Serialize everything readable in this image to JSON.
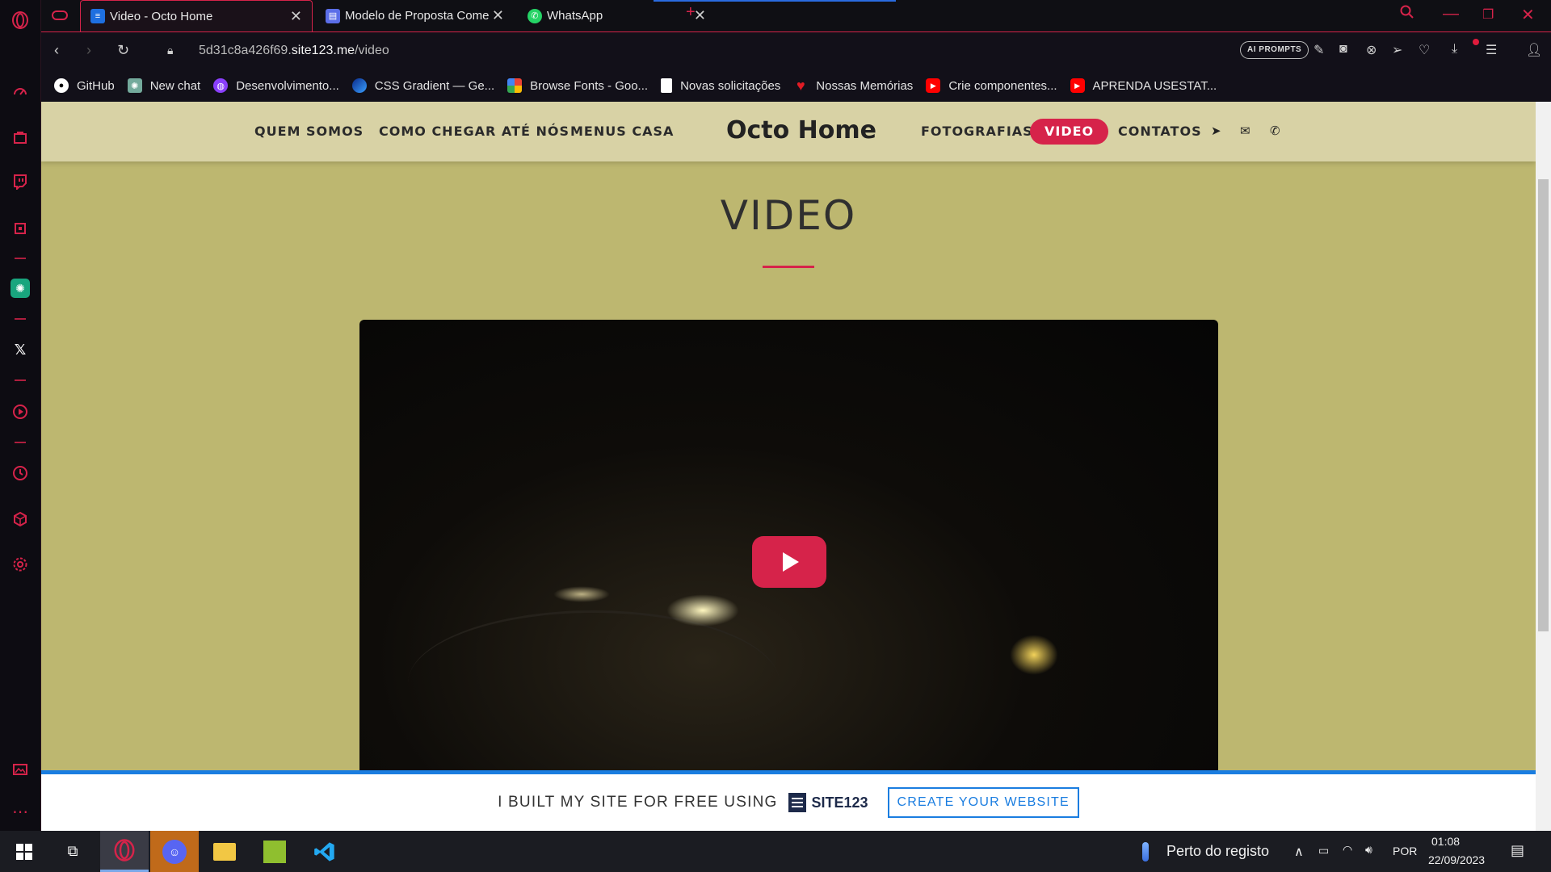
{
  "browser": {
    "tabs": [
      {
        "title": "Video - Octo Home",
        "active": true,
        "favicon": "site123-icon"
      },
      {
        "title": "Modelo de Proposta Come",
        "active": false,
        "favicon": "docs-icon"
      },
      {
        "title": "WhatsApp",
        "active": false,
        "favicon": "whatsapp-icon"
      }
    ],
    "new_tab_symbol": "+",
    "url_prefix": "5d31c8a426f69.",
    "url_host": "site123.me",
    "url_path": "/video",
    "ai_prompts_label": "AI PROMPTS",
    "bookmarks": [
      {
        "label": "GitHub",
        "icon": "github-icon",
        "color": "#ffffff"
      },
      {
        "label": "New chat",
        "icon": "chatgpt-icon",
        "color": "#74aa9c"
      },
      {
        "label": "Desenvolvimento...",
        "icon": "purple-circle-icon",
        "color": "#8a3ffc"
      },
      {
        "label": "CSS Gradient — Ge...",
        "icon": "gradient-icon",
        "color": "#1e63d6"
      },
      {
        "label": "Browse Fonts - Goo...",
        "icon": "google-fonts-icon",
        "color": "#f4b400"
      },
      {
        "label": "Novas solicitações",
        "icon": "document-icon",
        "color": "#ffffff"
      },
      {
        "label": "Nossas Memórias",
        "icon": "heart-icon",
        "color": "#e01b24"
      },
      {
        "label": "Crie componentes...",
        "icon": "youtube-icon",
        "color": "#ff0000"
      },
      {
        "label": "APRENDA USESTAT...",
        "icon": "youtube-icon",
        "color": "#ff0000"
      }
    ]
  },
  "site": {
    "nav_left": [
      "QUEM SOMOS",
      "COMO CHEGAR ATÉ NÓS",
      "MENUS CASA"
    ],
    "logo": "Octo Home",
    "nav_right": [
      "FOTOGRAFIAS",
      "VIDEO",
      "CONTATOS"
    ],
    "active_nav": "VIDEO",
    "page_title": "VIDEO",
    "accent": "#d6234a",
    "background": "#bdb770",
    "header_bg": "#d8d2a5",
    "promo_text": "I BUILT MY SITE FOR FREE USING",
    "promo_brand_prefix": "SITE",
    "promo_brand_suffix": "123",
    "promo_cta": "CREATE YOUR WEBSITE"
  },
  "taskbar": {
    "weather_text": "Perto do registo",
    "language": "POR",
    "time": "01:08",
    "date": "22/09/2023",
    "apps": [
      "windows-start-icon",
      "task-view-icon",
      "opera-gx-icon",
      "discord-icon",
      "file-explorer-icon",
      "app-icon",
      "vscode-icon"
    ]
  }
}
